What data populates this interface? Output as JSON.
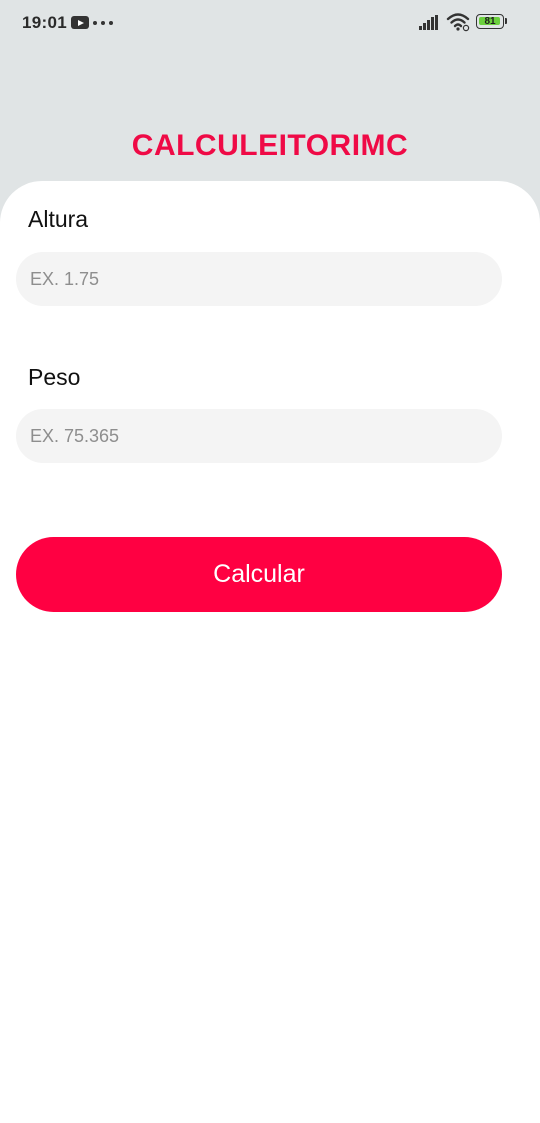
{
  "status_bar": {
    "time": "19:01",
    "battery_level": "81",
    "icons": [
      "youtube-icon",
      "more-dots-icon",
      "signal-icon",
      "wifi-icon",
      "battery-icon"
    ]
  },
  "app": {
    "title": "CALCULEITORIMC",
    "accent_color": "#ff0042",
    "title_color": "#ef0a46"
  },
  "form": {
    "height": {
      "label": "Altura",
      "placeholder": "EX. 1.75",
      "value": ""
    },
    "weight": {
      "label": "Peso",
      "placeholder": "EX. 75.365",
      "value": ""
    },
    "submit_label": "Calcular"
  }
}
